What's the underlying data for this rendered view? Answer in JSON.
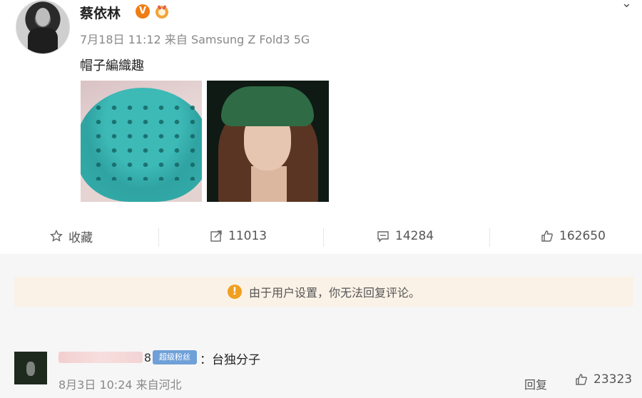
{
  "post": {
    "username": "蔡依林",
    "verified_badge": "V",
    "timestamp": "7月18日 11:12",
    "source_label": "来自",
    "source": "Samsung Z Fold3 5G",
    "content": "帽子編織趣"
  },
  "actions": {
    "favorite_label": "收藏",
    "repost_count": "11013",
    "comment_count": "14284",
    "like_count": "162650"
  },
  "notice": {
    "text": "由于用户设置，你无法回复评论。"
  },
  "comment": {
    "username_suffix": "8",
    "badge": "超级粉丝",
    "text": "：台独分子",
    "timestamp": "8月3日 10:24",
    "location": "来自河北",
    "reply_label": "回复",
    "like_count": "23323"
  },
  "icons": [
    "medal-icon",
    "chevron-down-icon",
    "star-icon",
    "repost-icon",
    "comment-icon",
    "thumbs-up-icon",
    "warning-icon"
  ],
  "colors": {
    "verified": "#f07c13",
    "notice_bg": "#fbf2e7",
    "warning": "#f0a020",
    "badge": "#6fa0d8"
  }
}
